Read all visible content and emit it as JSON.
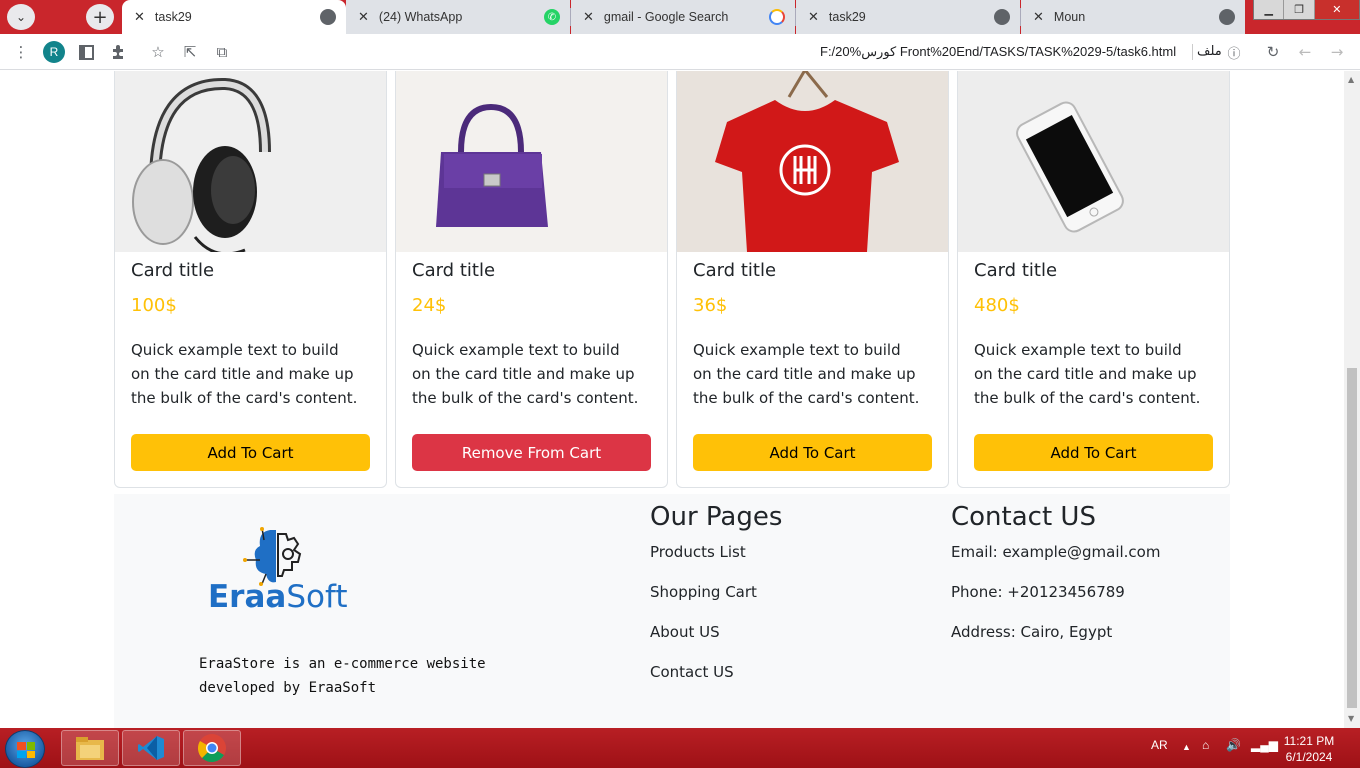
{
  "browser": {
    "tabs": [
      {
        "title": "task29",
        "favicon": "globe-icon",
        "active": true
      },
      {
        "title": "(24) WhatsApp",
        "favicon": "whatsapp-icon",
        "active": false
      },
      {
        "title": "gmail - Google Search",
        "favicon": "google-icon",
        "active": false
      },
      {
        "title": "task29",
        "favicon": "globe-icon",
        "active": false
      },
      {
        "title": "Moun",
        "favicon": "globe-icon",
        "active": false
      }
    ],
    "profile_initial": "R",
    "url": "F:/20%كورس Front%20End/TASKS/TASK%2029-5/task6.html",
    "url_label": "ملف"
  },
  "cards": [
    {
      "title": "Card title",
      "price": "100$",
      "text": "Quick example text to build on the card title and make up the bulk of the card's content.",
      "button": "Add To Cart",
      "button_style": "warning",
      "image": "headphones"
    },
    {
      "title": "Card title",
      "price": "24$",
      "text": "Quick example text to build on the card title and make up the bulk of the card's content.",
      "button": "Remove From Cart",
      "button_style": "danger",
      "image": "handbag"
    },
    {
      "title": "Card title",
      "price": "36$",
      "text": "Quick example text to build on the card title and make up the bulk of the card's content.",
      "button": "Add To Cart",
      "button_style": "warning",
      "image": "t-shirt"
    },
    {
      "title": "Card title",
      "price": "480$",
      "text": "Quick example text to build on the card title and make up the bulk of the card's content.",
      "button": "Add To Cart",
      "button_style": "warning",
      "image": "smartphone"
    }
  ],
  "footer": {
    "brand_bold": "Eraa",
    "brand_light": "Soft",
    "about": "EraaStore is an e-commerce website developed by EraaSoft",
    "pages_heading": "Our Pages",
    "pages": [
      "Products List",
      "Shopping Cart",
      "About US",
      "Contact US"
    ],
    "contact_heading": "Contact US",
    "contact": [
      "Email: example@gmail.com",
      "Phone: +20123456789",
      "Address: Cairo, Egypt"
    ]
  },
  "taskbar": {
    "language": "AR",
    "time": "11:21 PM",
    "date": "6/1/2024",
    "apps": [
      "file-explorer-icon",
      "vscode-icon",
      "chrome-icon"
    ]
  },
  "colors": {
    "warning": "#ffc107",
    "danger": "#dc3545",
    "brand": "#1f6fc5",
    "taskbar": "#b81f24"
  }
}
